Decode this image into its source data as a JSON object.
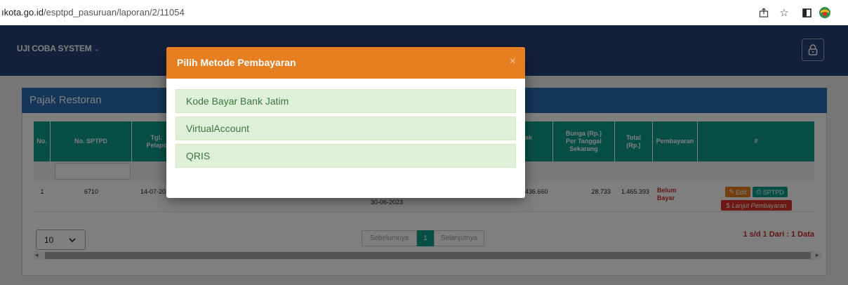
{
  "browser": {
    "url_prefix": "ıkota.go.id",
    "url_path": "/esptpd_pasuruan/laporan/2/11054",
    "icons": [
      "share-icon",
      "star-icon",
      "sidebar-icon",
      "extension-icon"
    ]
  },
  "header": {
    "brand": "UJI COBA SYSTEM",
    "brand_caret": "⌄",
    "lock_icon": "lock-icon"
  },
  "panel": {
    "title": "Pajak Restoran"
  },
  "table": {
    "headers": [
      "No.",
      "No. SPTPD",
      "Tgl. Pelapor",
      "",
      "",
      "",
      "h Pajak (p.)",
      "Bunga (Rp.) Per Tanggal Sekarang",
      "Total (Rp.)",
      "Pembayaran",
      "#"
    ],
    "row": {
      "no": "1",
      "sptpd": "6710",
      "tgl": "14-07-20",
      "date2": "30-06-2023",
      "pajak": "436.660",
      "bunga": "28.733",
      "total": "1.465.393",
      "status": "Belum Bayar",
      "edit": "Edit",
      "sptpd_btn": "SPTPD",
      "lanjut": "Lanjut Pembayaran"
    }
  },
  "footer": {
    "page_size": "10",
    "prev": "Sebelumnya",
    "page": "1",
    "next": "Selanjutnya",
    "summary": "1 s/d 1 Dari : 1 Data"
  },
  "modal": {
    "title": "Pilih Metode Pembayaran",
    "close": "×",
    "options": [
      "Kode Bayar Bank Jatim",
      "VirtualAccount",
      "QRIS"
    ]
  },
  "colors": {
    "topbar": "#29437a",
    "panel_head": "#2a6db0",
    "table_head": "#0f9f8a",
    "modal_head": "#e67e22",
    "option_bg": "#dff0d8",
    "option_text": "#3c763d",
    "status_red": "#c9302c"
  }
}
